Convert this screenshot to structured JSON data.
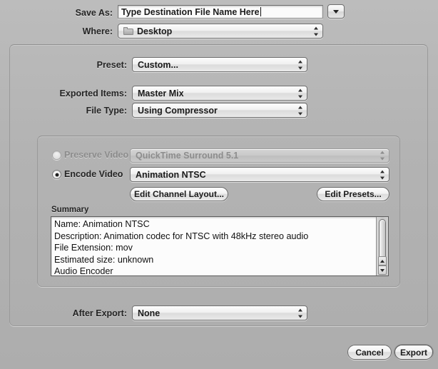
{
  "dialog": {
    "save_as": {
      "label": "Save As:",
      "value": "Type Destination File Name Here",
      "placeholder": "Type Destination File Name Here",
      "expand_icon": "chevron-down-icon"
    },
    "where": {
      "label": "Where:",
      "value": "Desktop",
      "icon": "folder-icon"
    },
    "preset": {
      "label": "Preset:",
      "value": "Custom..."
    },
    "exported_items": {
      "label": "Exported Items:",
      "value": "Master Mix"
    },
    "file_type": {
      "label": "File Type:",
      "value": "Using Compressor"
    },
    "video_options": {
      "preserve_video": {
        "label": "Preserve Video",
        "selected": false,
        "enabled": false,
        "popup_value": "QuickTime Surround 5.1"
      },
      "encode_video": {
        "label": "Encode Video",
        "selected": true,
        "enabled": true,
        "popup_value": "Animation NTSC"
      },
      "edit_channel_layout_label": "Edit Channel Layout...",
      "edit_presets_label": "Edit Presets..."
    },
    "summary": {
      "title": "Summary",
      "lines": [
        "Name: Animation NTSC",
        "Description: Animation codec for NTSC with 48kHz stereo audio",
        "File Extension: mov",
        "Estimated size: unknown",
        "Audio Encoder"
      ]
    },
    "after_export": {
      "label": "After Export:",
      "value": "None"
    },
    "buttons": {
      "cancel": "Cancel",
      "export": "Export"
    }
  },
  "colors": {
    "window_bg": "#b5b5b5",
    "field_bg": "#fbfbfb",
    "text": "#1c1c1c",
    "disabled_text": "#8d8d8d",
    "border": "#6f6f6f"
  }
}
